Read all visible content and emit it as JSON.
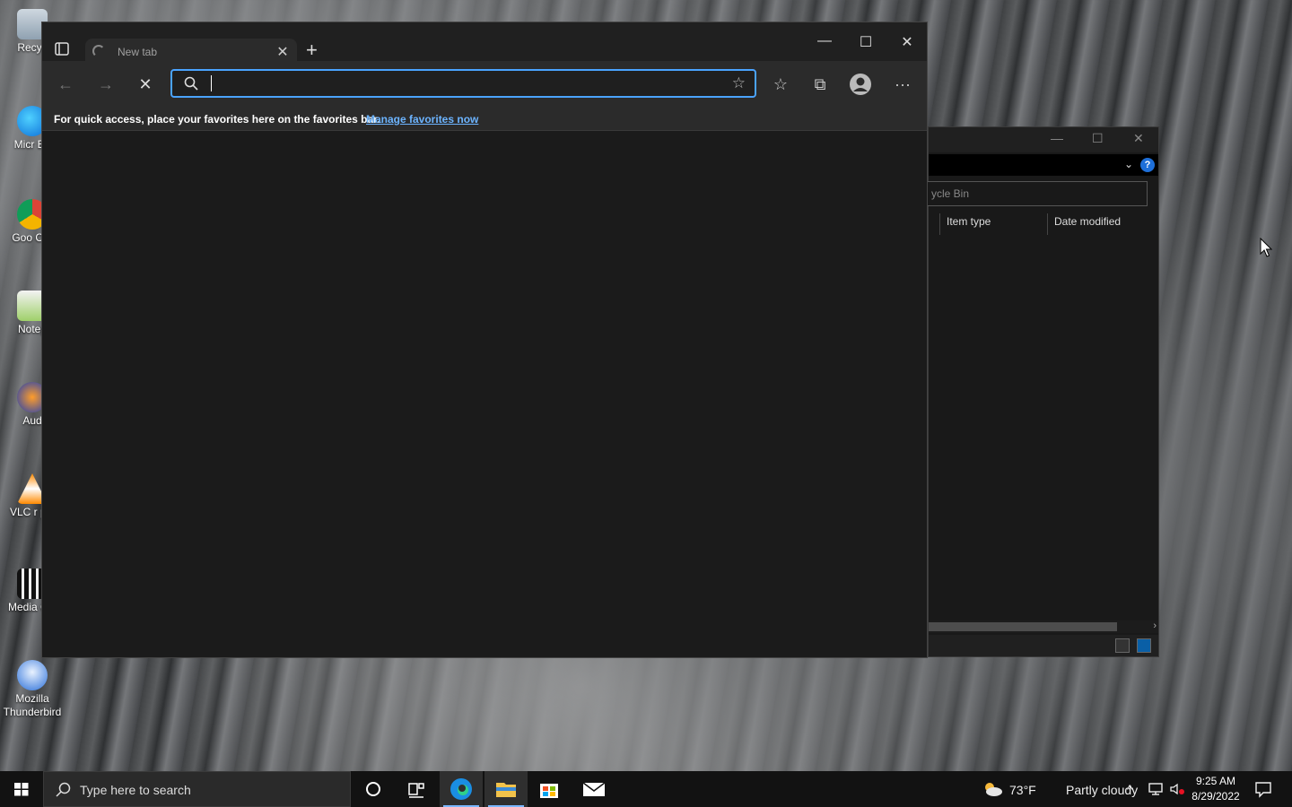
{
  "desktop": {
    "icons": [
      {
        "label": "Recyc"
      },
      {
        "label": "Micr Ed"
      },
      {
        "label": "Goo Chr"
      },
      {
        "label": "Notep"
      },
      {
        "label": "Aud"
      },
      {
        "label": "VLC r pla"
      },
      {
        "label": "Media Cla"
      },
      {
        "label": "Mozilla Thunderbird"
      }
    ]
  },
  "explorer": {
    "search_placeholder": "ycle Bin",
    "columns": [
      "Item type",
      "Date modified"
    ],
    "help_label": "?"
  },
  "edge": {
    "tab": {
      "title": "New tab",
      "close": "✕"
    },
    "new_tab": "+",
    "window": {
      "minimize": "—",
      "maximize": "☐",
      "close": "✕"
    },
    "address": {
      "value": "",
      "placeholder": ""
    },
    "favorites_bar": {
      "message": "For quick access, place your favorites here on the favorites bar.",
      "link": "Manage favorites now"
    },
    "accent": "#4aa3ff"
  },
  "taskbar": {
    "search_placeholder": "Type here to search",
    "weather": {
      "temp": "73°F",
      "condition": "Partly cloudy"
    },
    "clock": {
      "time": "9:25 AM",
      "date": "8/29/2022"
    }
  }
}
